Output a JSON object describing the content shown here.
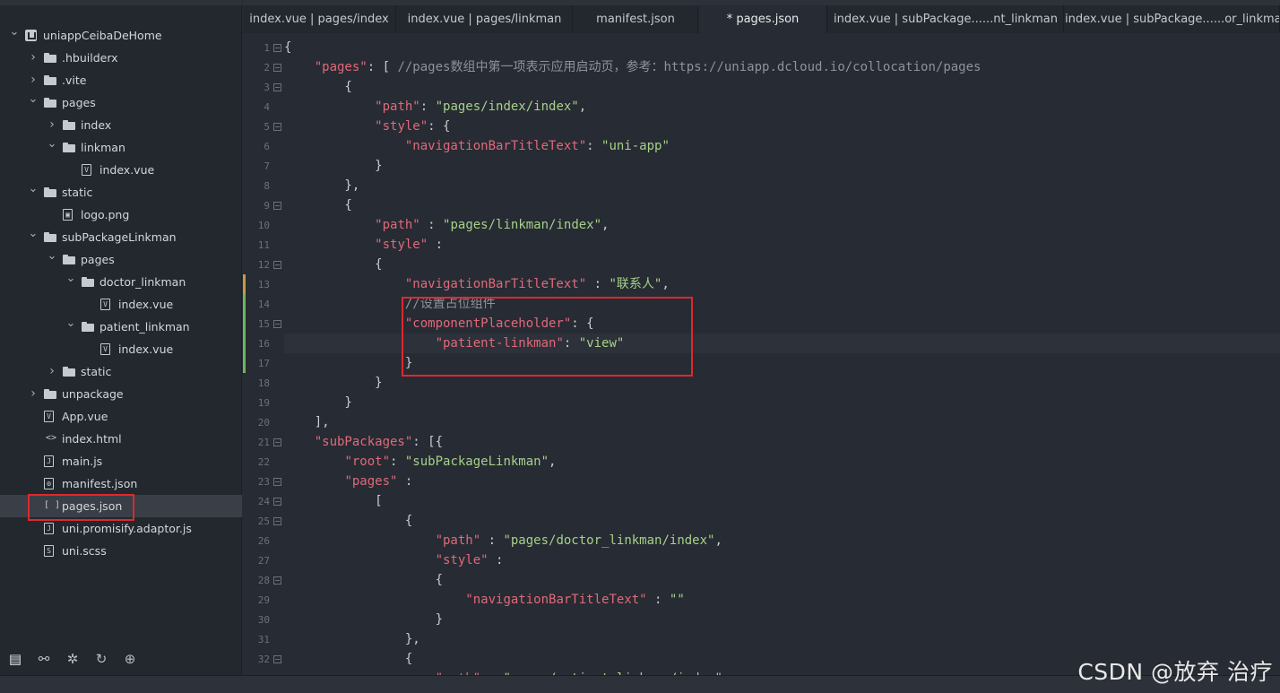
{
  "explorer": {
    "items": [
      {
        "label": "uniappCeibaDeHome",
        "icon": "project-root-icon",
        "depth": 0,
        "expanded": true,
        "folder": true,
        "root": true
      },
      {
        "label": ".hbuilderx",
        "icon": "folder-icon",
        "depth": 1,
        "expanded": false,
        "folder": true
      },
      {
        "label": ".vite",
        "icon": "folder-icon",
        "depth": 1,
        "expanded": false,
        "folder": true
      },
      {
        "label": "pages",
        "icon": "folder-icon",
        "depth": 1,
        "expanded": true,
        "folder": true
      },
      {
        "label": "index",
        "icon": "folder-icon",
        "depth": 2,
        "expanded": false,
        "folder": true
      },
      {
        "label": "linkman",
        "icon": "folder-icon",
        "depth": 2,
        "expanded": true,
        "folder": true
      },
      {
        "label": "index.vue",
        "icon": "vue-file-icon",
        "glyph": "V",
        "depth": 3,
        "folder": false
      },
      {
        "label": "static",
        "icon": "folder-icon",
        "depth": 1,
        "expanded": true,
        "folder": true
      },
      {
        "label": "logo.png",
        "icon": "image-file-icon",
        "glyph": "▣",
        "depth": 2,
        "folder": false
      },
      {
        "label": "subPackageLinkman",
        "icon": "folder-icon",
        "depth": 1,
        "expanded": true,
        "folder": true
      },
      {
        "label": "pages",
        "icon": "folder-icon",
        "depth": 2,
        "expanded": true,
        "folder": true
      },
      {
        "label": "doctor_linkman",
        "icon": "folder-icon",
        "depth": 3,
        "expanded": true,
        "folder": true
      },
      {
        "label": "index.vue",
        "icon": "vue-file-icon",
        "glyph": "V",
        "depth": 4,
        "folder": false
      },
      {
        "label": "patient_linkman",
        "icon": "folder-icon",
        "depth": 3,
        "expanded": true,
        "folder": true
      },
      {
        "label": "index.vue",
        "icon": "vue-file-icon",
        "glyph": "V",
        "depth": 4,
        "folder": false
      },
      {
        "label": "static",
        "icon": "folder-icon",
        "depth": 2,
        "expanded": false,
        "folder": true
      },
      {
        "label": "unpackage",
        "icon": "folder-icon",
        "depth": 1,
        "expanded": false,
        "folder": true
      },
      {
        "label": "App.vue",
        "icon": "vue-file-icon",
        "glyph": "V",
        "depth": 1,
        "folder": false
      },
      {
        "label": "index.html",
        "icon": "html-file-icon",
        "glyph": "<>",
        "depth": 1,
        "folder": false
      },
      {
        "label": "main.js",
        "icon": "js-file-icon",
        "glyph": "J",
        "depth": 1,
        "folder": false
      },
      {
        "label": "manifest.json",
        "icon": "manifest-file-icon",
        "glyph": "⚙",
        "depth": 1,
        "folder": false
      },
      {
        "label": "pages.json",
        "icon": "json-file-icon",
        "glyph": "[ ]",
        "depth": 1,
        "folder": false,
        "selected": true
      },
      {
        "label": "uni.promisify.adaptor.js",
        "icon": "js-file-icon",
        "glyph": "J",
        "depth": 1,
        "folder": false
      },
      {
        "label": "uni.scss",
        "icon": "scss-file-icon",
        "glyph": "S",
        "depth": 1,
        "folder": false
      }
    ],
    "toolbar": [
      {
        "name": "project-explorer-icon",
        "glyph": "▤",
        "active": true
      },
      {
        "name": "search-binoculars-icon",
        "glyph": "⚯"
      },
      {
        "name": "debug-bug-icon",
        "glyph": "✲"
      },
      {
        "name": "source-control-icon",
        "glyph": "↻"
      },
      {
        "name": "plugin-globe-icon",
        "glyph": "⊕"
      }
    ]
  },
  "tabs": [
    {
      "label": "index.vue | pages/index",
      "active": false
    },
    {
      "label": "index.vue | pages/linkman",
      "active": false
    },
    {
      "label": "manifest.json",
      "active": false
    },
    {
      "label": "* pages.json",
      "active": true
    },
    {
      "label": "index.vue | subPackage......nt_linkman",
      "active": false
    },
    {
      "label": "index.vue | subPackage......or_linkman",
      "active": false
    }
  ],
  "editor": {
    "lines": [
      {
        "n": "1",
        "fold": true,
        "tokens": [
          [
            "p",
            "{"
          ]
        ]
      },
      {
        "n": "2",
        "fold": true,
        "tokens": [
          [
            "p",
            "    "
          ],
          [
            "k",
            "\"pages\""
          ],
          [
            "p",
            ": [ "
          ],
          [
            "c",
            "//pages数组中第一项表示应用启动页，参考：https://uniapp.dcloud.io/collocation/pages"
          ]
        ]
      },
      {
        "n": "3",
        "fold": true,
        "tokens": [
          [
            "p",
            "        {"
          ]
        ]
      },
      {
        "n": "4",
        "tokens": [
          [
            "p",
            "            "
          ],
          [
            "k",
            "\"path\""
          ],
          [
            "p",
            ": "
          ],
          [
            "s",
            "\"pages/index/index\""
          ],
          [
            "p",
            ","
          ]
        ]
      },
      {
        "n": "5",
        "fold": true,
        "tokens": [
          [
            "p",
            "            "
          ],
          [
            "k",
            "\"style\""
          ],
          [
            "p",
            ": {"
          ]
        ]
      },
      {
        "n": "6",
        "tokens": [
          [
            "p",
            "                "
          ],
          [
            "k",
            "\"navigationBarTitleText\""
          ],
          [
            "p",
            ": "
          ],
          [
            "s",
            "\"uni-app\""
          ]
        ]
      },
      {
        "n": "7",
        "tokens": [
          [
            "p",
            "            }"
          ]
        ]
      },
      {
        "n": "8",
        "tokens": [
          [
            "p",
            "        },"
          ]
        ]
      },
      {
        "n": "9",
        "fold": true,
        "tokens": [
          [
            "p",
            "        {"
          ]
        ]
      },
      {
        "n": "10",
        "tokens": [
          [
            "p",
            "            "
          ],
          [
            "k",
            "\"path\""
          ],
          [
            "p",
            " : "
          ],
          [
            "s",
            "\"pages/linkman/index\""
          ],
          [
            "p",
            ","
          ]
        ]
      },
      {
        "n": "11",
        "tokens": [
          [
            "p",
            "            "
          ],
          [
            "k",
            "\"style\""
          ],
          [
            "p",
            " :"
          ]
        ]
      },
      {
        "n": "12",
        "fold": true,
        "tokens": [
          [
            "p",
            "            {"
          ]
        ]
      },
      {
        "n": "13",
        "mod": "#c59a3c",
        "tokens": [
          [
            "p",
            "                "
          ],
          [
            "k",
            "\"navigationBarTitleText\""
          ],
          [
            "p",
            " : "
          ],
          [
            "s",
            "\"联系人\""
          ],
          [
            "p",
            ","
          ]
        ]
      },
      {
        "n": "14",
        "mod": "#6fb55c",
        "tokens": [
          [
            "p",
            "                "
          ],
          [
            "c",
            "//设置占位组件"
          ]
        ]
      },
      {
        "n": "15",
        "mod": "#6fb55c",
        "fold": true,
        "tokens": [
          [
            "p",
            "                "
          ],
          [
            "k",
            "\"componentPlaceholder\""
          ],
          [
            "p",
            ": {"
          ]
        ]
      },
      {
        "n": "16",
        "mod": "#6fb55c",
        "current": true,
        "tokens": [
          [
            "p",
            "                    "
          ],
          [
            "k",
            "\"patient-linkman\""
          ],
          [
            "p",
            ": "
          ],
          [
            "s",
            "\"view\""
          ]
        ]
      },
      {
        "n": "17",
        "mod": "#6fb55c",
        "tokens": [
          [
            "p",
            "                }"
          ]
        ]
      },
      {
        "n": "18",
        "tokens": [
          [
            "p",
            "            }"
          ]
        ]
      },
      {
        "n": "19",
        "tokens": [
          [
            "p",
            "        }"
          ]
        ]
      },
      {
        "n": "20",
        "tokens": [
          [
            "p",
            "    ],"
          ]
        ]
      },
      {
        "n": "21",
        "fold": true,
        "tokens": [
          [
            "p",
            "    "
          ],
          [
            "k",
            "\"subPackages\""
          ],
          [
            "p",
            ": [{"
          ]
        ]
      },
      {
        "n": "22",
        "tokens": [
          [
            "p",
            "        "
          ],
          [
            "k",
            "\"root\""
          ],
          [
            "p",
            ": "
          ],
          [
            "s",
            "\"subPackageLinkman\""
          ],
          [
            "p",
            ","
          ]
        ]
      },
      {
        "n": "23",
        "fold": true,
        "tokens": [
          [
            "p",
            "        "
          ],
          [
            "k",
            "\"pages\""
          ],
          [
            "p",
            " :"
          ]
        ]
      },
      {
        "n": "24",
        "fold": true,
        "tokens": [
          [
            "p",
            "            ["
          ]
        ]
      },
      {
        "n": "25",
        "fold": true,
        "tokens": [
          [
            "p",
            "                {"
          ]
        ]
      },
      {
        "n": "26",
        "tokens": [
          [
            "p",
            "                    "
          ],
          [
            "k",
            "\"path\""
          ],
          [
            "p",
            " : "
          ],
          [
            "s",
            "\"pages/doctor_linkman/index\""
          ],
          [
            "p",
            ","
          ]
        ]
      },
      {
        "n": "27",
        "tokens": [
          [
            "p",
            "                    "
          ],
          [
            "k",
            "\"style\""
          ],
          [
            "p",
            " :"
          ]
        ]
      },
      {
        "n": "28",
        "fold": true,
        "tokens": [
          [
            "p",
            "                    {"
          ]
        ]
      },
      {
        "n": "29",
        "tokens": [
          [
            "p",
            "                        "
          ],
          [
            "k",
            "\"navigationBarTitleText\""
          ],
          [
            "p",
            " : "
          ],
          [
            "s",
            "\"\""
          ]
        ]
      },
      {
        "n": "30",
        "tokens": [
          [
            "p",
            "                    }"
          ]
        ]
      },
      {
        "n": "31",
        "tokens": [
          [
            "p",
            "                },"
          ]
        ]
      },
      {
        "n": "32",
        "fold": true,
        "tokens": [
          [
            "p",
            "                {"
          ]
        ]
      },
      {
        "n": "",
        "tokens": [
          [
            "p",
            "                    "
          ],
          [
            "k",
            "\"path\""
          ],
          [
            "p",
            " : "
          ],
          [
            "s",
            "\"pages/patient_linkman/index\""
          ]
        ]
      }
    ]
  },
  "watermark": "CSDN @放弃        治疗"
}
